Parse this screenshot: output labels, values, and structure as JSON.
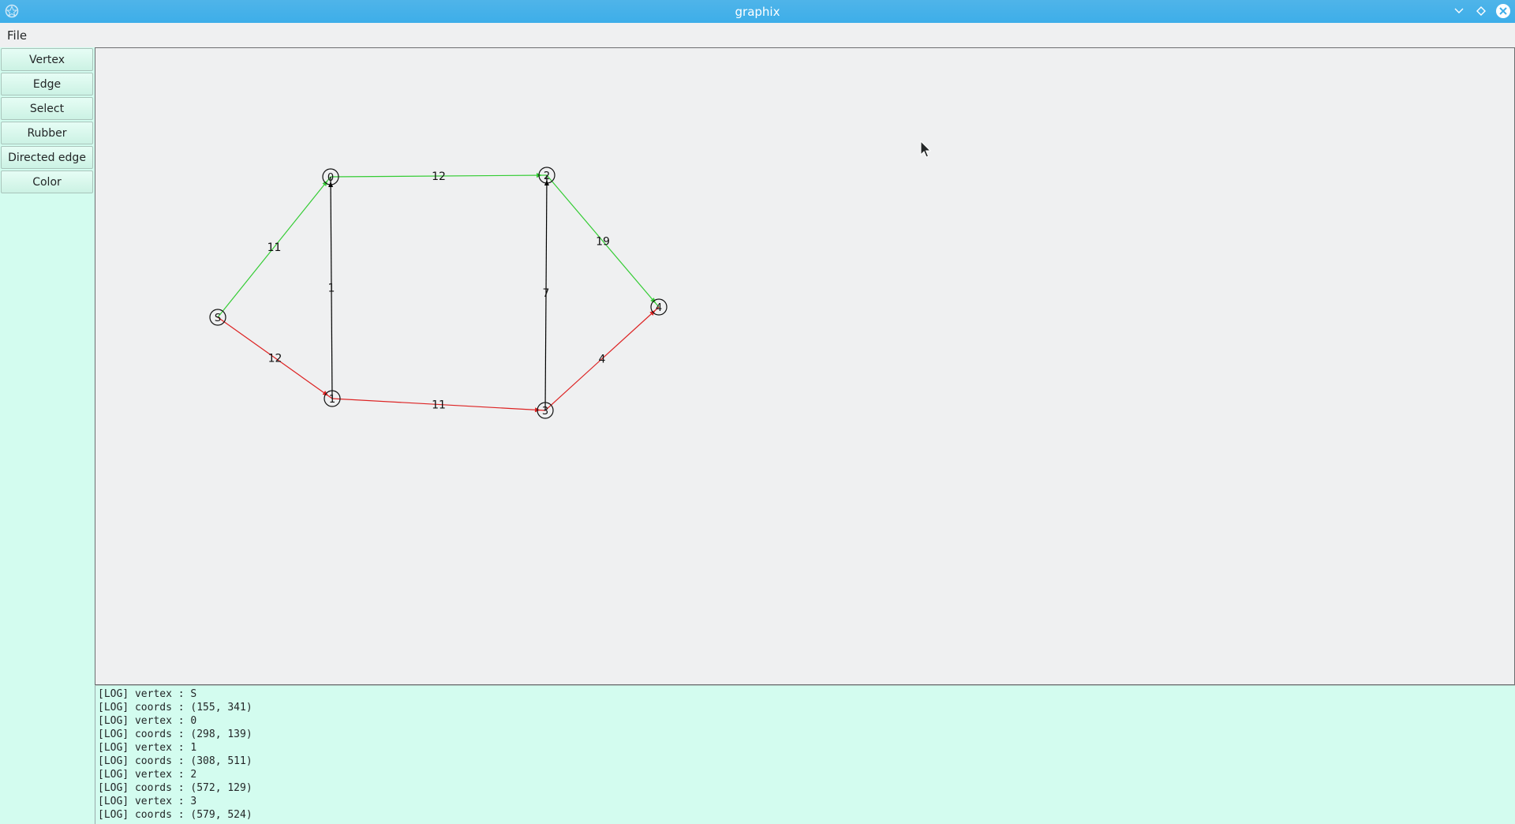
{
  "window": {
    "title": "graphix"
  },
  "menu": {
    "file": "File"
  },
  "tools": [
    {
      "label": "Vertex"
    },
    {
      "label": "Edge"
    },
    {
      "label": "Select"
    },
    {
      "label": "Rubber"
    },
    {
      "label": "Directed edge"
    },
    {
      "label": "Color"
    }
  ],
  "graph": {
    "vertices": [
      {
        "id": "S",
        "label": "S"
      },
      {
        "id": "0",
        "label": "0"
      },
      {
        "id": "1",
        "label": "1"
      },
      {
        "id": "2",
        "label": "2"
      },
      {
        "id": "3",
        "label": "3"
      },
      {
        "id": "4",
        "label": "4"
      }
    ],
    "edges": [
      {
        "from": "S",
        "to": "0",
        "weight": "11",
        "color": "#33cc33"
      },
      {
        "from": "0",
        "to": "2",
        "weight": "12",
        "color": "#33cc33"
      },
      {
        "from": "2",
        "to": "4",
        "weight": "19",
        "color": "#33cc33"
      },
      {
        "from": "S",
        "to": "1",
        "weight": "12",
        "color": "#dd2222"
      },
      {
        "from": "1",
        "to": "3",
        "weight": "11",
        "color": "#dd2222"
      },
      {
        "from": "3",
        "to": "4",
        "weight": "4",
        "color": "#dd2222"
      },
      {
        "from": "1",
        "to": "0",
        "weight": "1",
        "color": "#000000"
      },
      {
        "from": "3",
        "to": "2",
        "weight": "7",
        "color": "#000000"
      }
    ]
  },
  "log": [
    "[LOG] vertex : S",
    "[LOG] coords : (155, 341)",
    "[LOG] vertex : 0",
    "[LOG] coords : (298, 139)",
    "[LOG] vertex : 1",
    "[LOG] coords : (308, 511)",
    "[LOG] vertex : 2",
    "[LOG] coords : (572, 129)",
    "[LOG] vertex : 3",
    "[LOG] coords : (579, 524)"
  ]
}
